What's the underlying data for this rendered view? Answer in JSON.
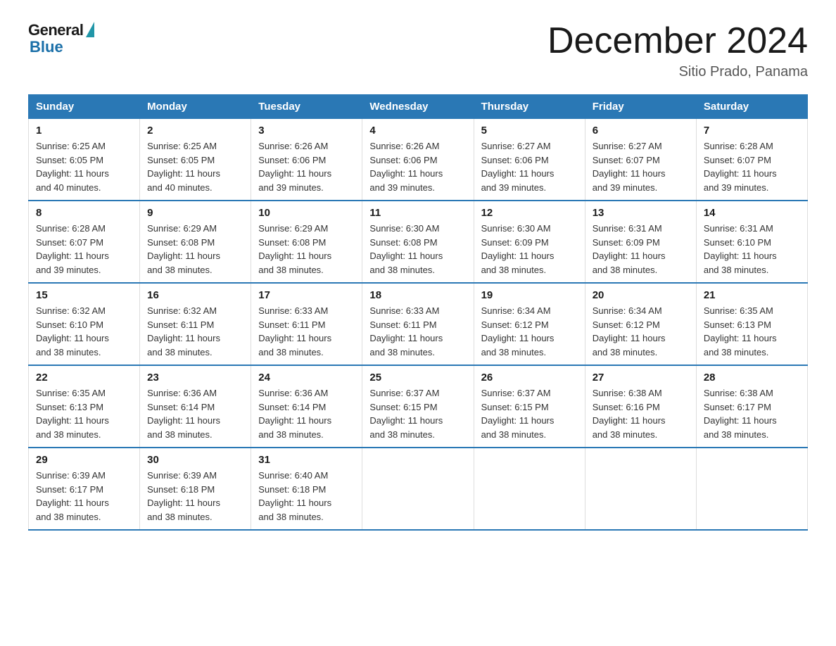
{
  "header": {
    "logo_general": "General",
    "logo_blue": "Blue",
    "title": "December 2024",
    "location": "Sitio Prado, Panama"
  },
  "days_of_week": [
    "Sunday",
    "Monday",
    "Tuesday",
    "Wednesday",
    "Thursday",
    "Friday",
    "Saturday"
  ],
  "weeks": [
    [
      {
        "day": "1",
        "sunrise": "6:25 AM",
        "sunset": "6:05 PM",
        "daylight": "11 hours and 40 minutes."
      },
      {
        "day": "2",
        "sunrise": "6:25 AM",
        "sunset": "6:05 PM",
        "daylight": "11 hours and 40 minutes."
      },
      {
        "day": "3",
        "sunrise": "6:26 AM",
        "sunset": "6:06 PM",
        "daylight": "11 hours and 39 minutes."
      },
      {
        "day": "4",
        "sunrise": "6:26 AM",
        "sunset": "6:06 PM",
        "daylight": "11 hours and 39 minutes."
      },
      {
        "day": "5",
        "sunrise": "6:27 AM",
        "sunset": "6:06 PM",
        "daylight": "11 hours and 39 minutes."
      },
      {
        "day": "6",
        "sunrise": "6:27 AM",
        "sunset": "6:07 PM",
        "daylight": "11 hours and 39 minutes."
      },
      {
        "day": "7",
        "sunrise": "6:28 AM",
        "sunset": "6:07 PM",
        "daylight": "11 hours and 39 minutes."
      }
    ],
    [
      {
        "day": "8",
        "sunrise": "6:28 AM",
        "sunset": "6:07 PM",
        "daylight": "11 hours and 39 minutes."
      },
      {
        "day": "9",
        "sunrise": "6:29 AM",
        "sunset": "6:08 PM",
        "daylight": "11 hours and 38 minutes."
      },
      {
        "day": "10",
        "sunrise": "6:29 AM",
        "sunset": "6:08 PM",
        "daylight": "11 hours and 38 minutes."
      },
      {
        "day": "11",
        "sunrise": "6:30 AM",
        "sunset": "6:08 PM",
        "daylight": "11 hours and 38 minutes."
      },
      {
        "day": "12",
        "sunrise": "6:30 AM",
        "sunset": "6:09 PM",
        "daylight": "11 hours and 38 minutes."
      },
      {
        "day": "13",
        "sunrise": "6:31 AM",
        "sunset": "6:09 PM",
        "daylight": "11 hours and 38 minutes."
      },
      {
        "day": "14",
        "sunrise": "6:31 AM",
        "sunset": "6:10 PM",
        "daylight": "11 hours and 38 minutes."
      }
    ],
    [
      {
        "day": "15",
        "sunrise": "6:32 AM",
        "sunset": "6:10 PM",
        "daylight": "11 hours and 38 minutes."
      },
      {
        "day": "16",
        "sunrise": "6:32 AM",
        "sunset": "6:11 PM",
        "daylight": "11 hours and 38 minutes."
      },
      {
        "day": "17",
        "sunrise": "6:33 AM",
        "sunset": "6:11 PM",
        "daylight": "11 hours and 38 minutes."
      },
      {
        "day": "18",
        "sunrise": "6:33 AM",
        "sunset": "6:11 PM",
        "daylight": "11 hours and 38 minutes."
      },
      {
        "day": "19",
        "sunrise": "6:34 AM",
        "sunset": "6:12 PM",
        "daylight": "11 hours and 38 minutes."
      },
      {
        "day": "20",
        "sunrise": "6:34 AM",
        "sunset": "6:12 PM",
        "daylight": "11 hours and 38 minutes."
      },
      {
        "day": "21",
        "sunrise": "6:35 AM",
        "sunset": "6:13 PM",
        "daylight": "11 hours and 38 minutes."
      }
    ],
    [
      {
        "day": "22",
        "sunrise": "6:35 AM",
        "sunset": "6:13 PM",
        "daylight": "11 hours and 38 minutes."
      },
      {
        "day": "23",
        "sunrise": "6:36 AM",
        "sunset": "6:14 PM",
        "daylight": "11 hours and 38 minutes."
      },
      {
        "day": "24",
        "sunrise": "6:36 AM",
        "sunset": "6:14 PM",
        "daylight": "11 hours and 38 minutes."
      },
      {
        "day": "25",
        "sunrise": "6:37 AM",
        "sunset": "6:15 PM",
        "daylight": "11 hours and 38 minutes."
      },
      {
        "day": "26",
        "sunrise": "6:37 AM",
        "sunset": "6:15 PM",
        "daylight": "11 hours and 38 minutes."
      },
      {
        "day": "27",
        "sunrise": "6:38 AM",
        "sunset": "6:16 PM",
        "daylight": "11 hours and 38 minutes."
      },
      {
        "day": "28",
        "sunrise": "6:38 AM",
        "sunset": "6:17 PM",
        "daylight": "11 hours and 38 minutes."
      }
    ],
    [
      {
        "day": "29",
        "sunrise": "6:39 AM",
        "sunset": "6:17 PM",
        "daylight": "11 hours and 38 minutes."
      },
      {
        "day": "30",
        "sunrise": "6:39 AM",
        "sunset": "6:18 PM",
        "daylight": "11 hours and 38 minutes."
      },
      {
        "day": "31",
        "sunrise": "6:40 AM",
        "sunset": "6:18 PM",
        "daylight": "11 hours and 38 minutes."
      },
      null,
      null,
      null,
      null
    ]
  ],
  "labels": {
    "sunrise": "Sunrise:",
    "sunset": "Sunset:",
    "daylight": "Daylight:"
  }
}
